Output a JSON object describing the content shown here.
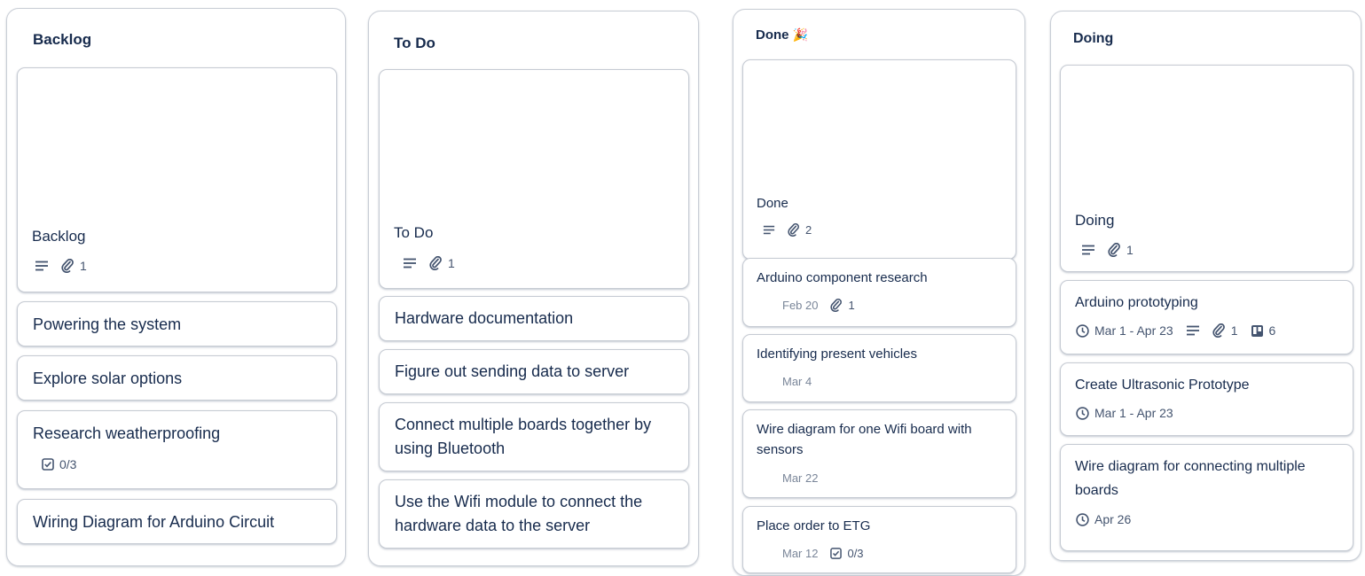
{
  "lists": [
    {
      "title": "Backlog",
      "cover_card": {
        "title": "Backlog",
        "attachments": "1"
      },
      "cards": [
        {
          "title": "Powering the system"
        },
        {
          "title": "Explore solar options"
        },
        {
          "title": "Research weatherproofing",
          "checklist": "0/3"
        },
        {
          "title": "Wiring Diagram for Arduino Circuit"
        }
      ]
    },
    {
      "title": "To Do",
      "cover_card": {
        "title": "To Do",
        "attachments": "1"
      },
      "cards": [
        {
          "title": "Hardware documentation"
        },
        {
          "title": "Figure out sending data to server"
        },
        {
          "title": "Connect multiple boards together by using Bluetooth"
        },
        {
          "title": "Use the Wifi module to connect the hardware data to the server"
        }
      ]
    },
    {
      "title": "Done",
      "title_emoji": "🎉",
      "cover_card": {
        "title": "Done",
        "attachments": "2"
      },
      "cards": [
        {
          "title": "Arduino component research",
          "date": "Feb 20",
          "attachments": "1"
        },
        {
          "title": "Identifying present vehicles",
          "date": "Mar 4"
        },
        {
          "title": "Wire diagram for one Wifi board with sensors",
          "date": "Mar 22"
        },
        {
          "title": "Place order to ETG",
          "date": "Mar 12",
          "checklist": "0/3"
        }
      ]
    },
    {
      "title": "Doing",
      "cover_card": {
        "title": "Doing",
        "attachments": "1"
      },
      "cards": [
        {
          "title": "Arduino prototyping",
          "dates": "Mar 1 - Apr 23",
          "attachments": "1",
          "trello_cards": "6"
        },
        {
          "title": "Create Ultrasonic Prototype",
          "dates": "Mar 1 - Apr 23"
        },
        {
          "title": "Wire diagram for connecting multiple boards",
          "dates": "Apr 26"
        }
      ]
    }
  ],
  "icons": {
    "description": "description-icon",
    "attachment": "paperclip-icon",
    "checklist": "checklist-icon",
    "clock": "clock-icon",
    "trello": "trello-board-icon"
  },
  "colors": {
    "text": "#172b4d",
    "muted": "#44546f",
    "border": "#c6cbd3"
  }
}
